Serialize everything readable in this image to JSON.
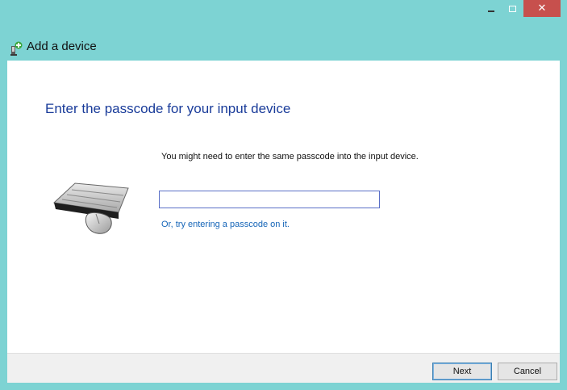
{
  "window": {
    "title": "Add a device",
    "controls": {
      "minimize_icon": "minimize-icon",
      "maximize_icon": "maximize-icon",
      "close_glyph": "✕"
    },
    "colors": {
      "frame": "#7dd3d3",
      "close": "#c7504d",
      "heading": "#1a3c9a",
      "link": "#1565b8"
    }
  },
  "main": {
    "heading": "Enter the passcode for your input device",
    "instruction": "You might need to enter the same passcode into the input device.",
    "passcode": {
      "value": "",
      "placeholder": ""
    },
    "alt_link": "Or, try entering a passcode on it.",
    "device_icon": "keyboard-mouse-icon"
  },
  "footer": {
    "next_label": "Next",
    "cancel_label": "Cancel"
  }
}
